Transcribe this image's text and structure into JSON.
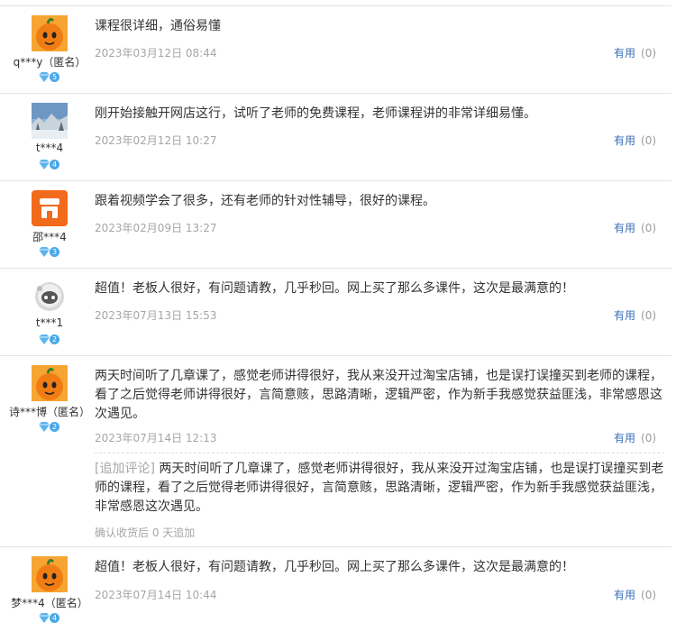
{
  "reviews": [
    {
      "user": "q***y（匿名）",
      "level": "5",
      "avatar": "orange-mascot-avatar",
      "content": "课程很详细，通俗易懂",
      "date": "2023年03月12日 08:44",
      "useful_label": "有用",
      "useful_count": "(0)"
    },
    {
      "user": "t***4",
      "level": "4",
      "avatar": "winter-landscape-avatar",
      "content": "刚开始接触开网店这行，试听了老师的免费课程，老师课程讲的非常详细易懂。",
      "date": "2023年02月12日 10:27",
      "useful_label": "有用",
      "useful_count": "(0)"
    },
    {
      "user": "邵***4",
      "level": "3",
      "avatar": "orange-shop-avatar",
      "content": "跟着视频学会了很多，还有老师的针对性辅导，很好的课程。",
      "date": "2023年02月09日 13:27",
      "useful_label": "有用",
      "useful_count": "(0)"
    },
    {
      "user": "t***1",
      "level": "2",
      "avatar": "grey-astronaut-avatar",
      "content": "超值！老板人很好，有问题请教，几乎秒回。网上买了那么多课件，这次是最满意的！",
      "date": "2023年07月13日 15:53",
      "useful_label": "有用",
      "useful_count": "(0)"
    },
    {
      "user": "诗***博（匿名）",
      "level": "2",
      "avatar": "orange-mascot-avatar",
      "content": "两天时间听了几章课了，感觉老师讲得很好，我从来没开过淘宝店铺，也是误打误撞买到老师的课程，看了之后觉得老师讲得很好，言简意赅，思路清晰，逻辑严密，作为新手我感觉获益匪浅，非常感恩这次遇见。",
      "date": "2023年07月14日 12:13",
      "useful_label": "有用",
      "useful_count": "(0)",
      "followup_tag": "[追加评论]",
      "followup": "两天时间听了几章课了，感觉老师讲得很好，我从来没开过淘宝店铺，也是误打误撞买到老师的课程，看了之后觉得老师讲得很好，言简意赅，思路清晰，逻辑严密，作为新手我感觉获益匪浅，非常感恩这次遇见。",
      "followup_meta": "确认收货后 0 天追加"
    },
    {
      "user": "梦***4（匿名）",
      "level": "4",
      "avatar": "orange-mascot-avatar",
      "content": "超值！老板人很好，有问题请教，几乎秒回。网上买了那么多课件，这次是最满意的！",
      "date": "2023年07月14日 10:44",
      "useful_label": "有用",
      "useful_count": "(0)"
    }
  ],
  "colors": {
    "link": "#3b6fb6",
    "muted": "#a6a6a6",
    "divider": "#e4e4e4",
    "mascot": "#f08a1c",
    "diamond": "#4aa8e8"
  }
}
